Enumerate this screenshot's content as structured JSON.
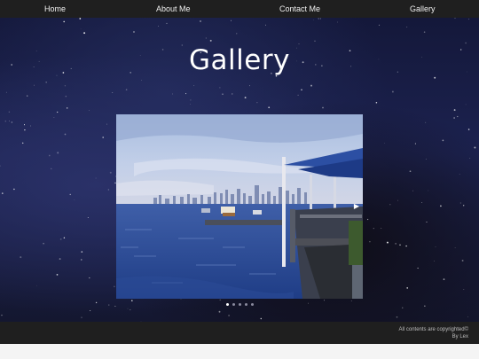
{
  "nav": {
    "items": [
      "Home",
      "About Me",
      "Contact Me",
      "Gallery"
    ]
  },
  "page": {
    "title": "Gallery"
  },
  "gallery": {
    "slide_count": 5,
    "active_slide_index": 0,
    "next_icon": "play-triangle-icon"
  },
  "footer": {
    "line1": "All contents are copyrighted©",
    "line2": "By Lex"
  },
  "colors": {
    "nav_bg": "#1f1f1f",
    "footer_bg": "#1f1f1f",
    "text": "#ffffff",
    "space_bg": "#1c2250"
  }
}
